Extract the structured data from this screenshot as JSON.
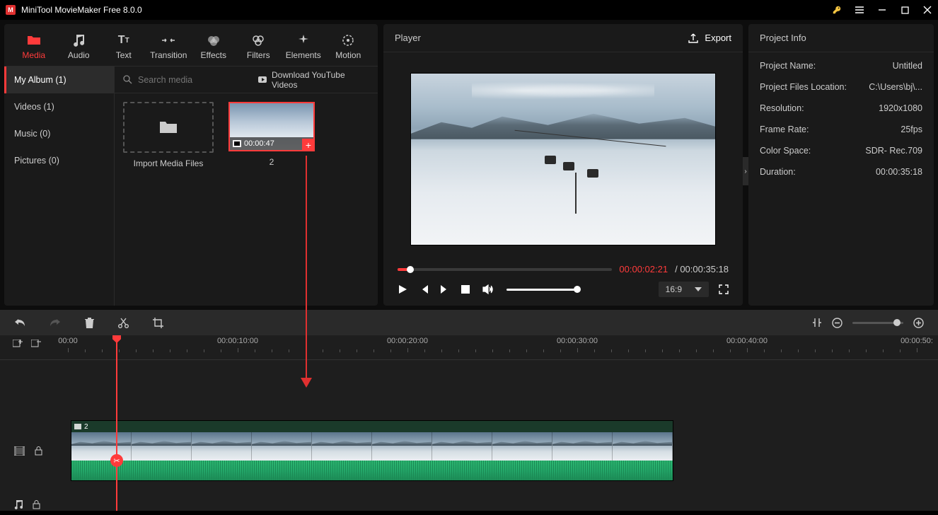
{
  "app": {
    "title": "MiniTool MovieMaker Free 8.0.0"
  },
  "topTabs": [
    {
      "id": "media",
      "label": "Media"
    },
    {
      "id": "audio",
      "label": "Audio"
    },
    {
      "id": "text",
      "label": "Text"
    },
    {
      "id": "transition",
      "label": "Transition"
    },
    {
      "id": "effects",
      "label": "Effects"
    },
    {
      "id": "filters",
      "label": "Filters"
    },
    {
      "id": "elements",
      "label": "Elements"
    },
    {
      "id": "motion",
      "label": "Motion"
    }
  ],
  "sidebar": [
    {
      "id": "my-album",
      "label": "My Album (1)"
    },
    {
      "id": "videos",
      "label": "Videos (1)"
    },
    {
      "id": "music",
      "label": "Music (0)"
    },
    {
      "id": "pictures",
      "label": "Pictures (0)"
    }
  ],
  "search": {
    "placeholder": "Search media",
    "download_label": "Download YouTube Videos"
  },
  "media": {
    "import_label": "Import Media Files",
    "clip": {
      "duration": "00:00:47",
      "name": "2"
    }
  },
  "player": {
    "title": "Player",
    "export": "Export",
    "current": "00:00:02:21",
    "total": "00:00:35:18",
    "aspect": "16:9"
  },
  "info": {
    "title": "Project Info",
    "rows": [
      {
        "label": "Project Name:",
        "value": "Untitled"
      },
      {
        "label": "Project Files Location:",
        "value": "C:\\Users\\bj\\..."
      },
      {
        "label": "Resolution:",
        "value": "1920x1080"
      },
      {
        "label": "Frame Rate:",
        "value": "25fps"
      },
      {
        "label": "Color Space:",
        "value": "SDR- Rec.709"
      },
      {
        "label": "Duration:",
        "value": "00:00:35:18"
      }
    ]
  },
  "timeline": {
    "labels": [
      "00:00",
      "00:00:10:00",
      "00:00:20:00",
      "00:00:30:00",
      "00:00:40:00",
      "00:00:50:"
    ],
    "clip_name": "2"
  }
}
